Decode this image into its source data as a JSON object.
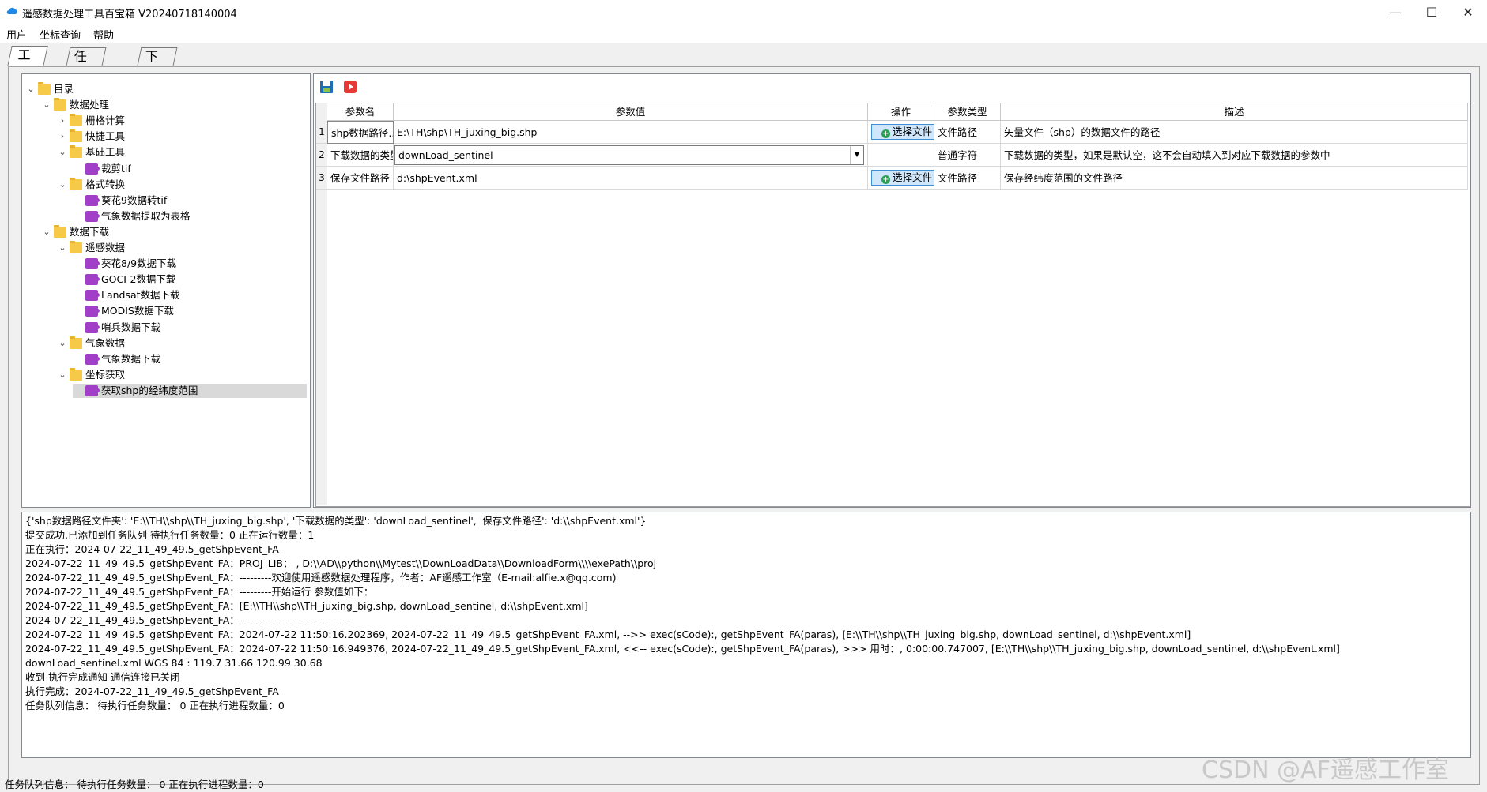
{
  "window": {
    "title": "遥感数据处理工具百宝箱   V20240718140004",
    "controls": {
      "minimize": "—",
      "maximize": "☐",
      "close": "✕"
    }
  },
  "menu": [
    "用户",
    "坐标查询",
    "帮助"
  ],
  "tabs": [
    "工具箱",
    "任务管理",
    "下载列表"
  ],
  "tree": [
    {
      "label": "目录",
      "level": 0,
      "type": "folder",
      "toggle": "⌄"
    },
    {
      "label": "数据处理",
      "level": 1,
      "type": "folder",
      "toggle": "⌄"
    },
    {
      "label": "栅格计算",
      "level": 2,
      "type": "folder",
      "toggle": "›"
    },
    {
      "label": "快捷工具",
      "level": 2,
      "type": "folder",
      "toggle": "›"
    },
    {
      "label": "基础工具",
      "level": 2,
      "type": "folder",
      "toggle": "⌄"
    },
    {
      "label": "裁剪tif",
      "level": 3,
      "type": "tool",
      "toggle": ""
    },
    {
      "label": "格式转换",
      "level": 2,
      "type": "folder",
      "toggle": "⌄"
    },
    {
      "label": "葵花9数据转tif",
      "level": 3,
      "type": "tool",
      "toggle": ""
    },
    {
      "label": "气象数据提取为表格",
      "level": 3,
      "type": "tool",
      "toggle": ""
    },
    {
      "label": "数据下载",
      "level": 1,
      "type": "folder",
      "toggle": "⌄"
    },
    {
      "label": "遥感数据",
      "level": 2,
      "type": "folder",
      "toggle": "⌄"
    },
    {
      "label": "葵花8/9数据下载",
      "level": 3,
      "type": "tool",
      "toggle": ""
    },
    {
      "label": "GOCI-2数据下载",
      "level": 3,
      "type": "tool",
      "toggle": ""
    },
    {
      "label": "Landsat数据下载",
      "level": 3,
      "type": "tool",
      "toggle": ""
    },
    {
      "label": "MODIS数据下载",
      "level": 3,
      "type": "tool",
      "toggle": ""
    },
    {
      "label": "哨兵数据下载",
      "level": 3,
      "type": "tool",
      "toggle": ""
    },
    {
      "label": "气象数据",
      "level": 2,
      "type": "folder",
      "toggle": "⌄"
    },
    {
      "label": "气象数据下载",
      "level": 3,
      "type": "tool",
      "toggle": ""
    },
    {
      "label": "坐标获取",
      "level": 2,
      "type": "folder",
      "toggle": "⌄"
    },
    {
      "label": "获取shp的经纬度范围",
      "level": 3,
      "type": "tool",
      "toggle": "",
      "selected": true
    }
  ],
  "toolbar": {
    "save_icon": "save-icon",
    "run_icon": "run-icon"
  },
  "grid": {
    "headers": [
      "参数名",
      "参数值",
      "操作",
      "参数类型",
      "描述"
    ],
    "rows": [
      {
        "num": "1",
        "name": "shp数据路径...",
        "value": "E:\\TH\\shp\\TH_juxing_big.shp",
        "action": "选择文件",
        "type": "文件路径",
        "desc": "矢量文件（shp）的数据文件的路径",
        "kind": "text"
      },
      {
        "num": "2",
        "name": "下载数据的类型",
        "value": "downLoad_sentinel",
        "action": "",
        "type": "普通字符",
        "desc": "下载数据的类型，如果是默认空，这不会自动填入到对应下载数据的参数中",
        "kind": "combo"
      },
      {
        "num": "3",
        "name": "保存文件路径",
        "value": "d:\\shpEvent.xml",
        "action": "选择文件",
        "type": "文件路径",
        "desc": "保存经纬度范围的文件路径",
        "kind": "text"
      }
    ]
  },
  "log": [
    "{'shp数据路径文件夹': 'E:\\\\TH\\\\shp\\\\TH_juxing_big.shp', '下载数据的类型': 'downLoad_sentinel', '保存文件路径': 'd:\\\\shpEvent.xml'}",
    "提交成功,已添加到任务队列   待执行任务数量：0   正在运行数量：1",
    "正在执行：2024-07-22_11_49_49.5_getShpEvent_FA",
    "2024-07-22_11_49_49.5_getShpEvent_FA：PROJ_LIB：  , D:\\\\AD\\\\python\\\\Mytest\\\\DownLoadData\\\\DownloadForm\\\\\\\\exePath\\\\proj",
    "2024-07-22_11_49_49.5_getShpEvent_FA：---------欢迎使用遥感数据处理程序，作者：AF遥感工作室（E-mail:alfie.x@qq.com)",
    "2024-07-22_11_49_49.5_getShpEvent_FA：---------开始运行    参数值如下：",
    "2024-07-22_11_49_49.5_getShpEvent_FA：[E:\\\\TH\\\\shp\\\\TH_juxing_big.shp, downLoad_sentinel, d:\\\\shpEvent.xml]",
    "2024-07-22_11_49_49.5_getShpEvent_FA：-------------------------------",
    "2024-07-22_11_49_49.5_getShpEvent_FA：2024-07-22 11:50:16.202369, 2024-07-22_11_49_49.5_getShpEvent_FA.xml, -->> exec(sCode):, getShpEvent_FA(paras), [E:\\\\TH\\\\shp\\\\TH_juxing_big.shp, downLoad_sentinel, d:\\\\shpEvent.xml]",
    "2024-07-22_11_49_49.5_getShpEvent_FA：2024-07-22 11:50:16.949376, 2024-07-22_11_49_49.5_getShpEvent_FA.xml, <<-- exec(sCode):, getShpEvent_FA(paras),    >>>  用时：, 0:00:00.747007, [E:\\\\TH\\\\shp\\\\TH_juxing_big.shp, downLoad_sentinel, d:\\\\shpEvent.xml]",
    "downLoad_sentinel.xml WGS 84 : 119.7 31.66 120.99 30.68",
    "收到 执行完成通知 通信连接已关闭",
    "执行完成：2024-07-22_11_49_49.5_getShpEvent_FA",
    "任务队列信息：   待执行任务数量： 0   正在执行进程数量：0"
  ],
  "status": "任务队列信息：   待执行任务数量： 0   正在执行进程数量：0",
  "watermark": "CSDN @AF遥感工作室"
}
